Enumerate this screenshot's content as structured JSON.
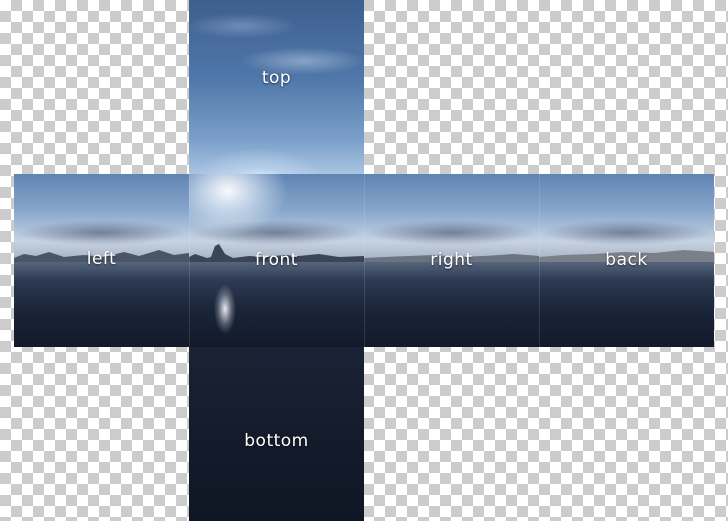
{
  "faces": {
    "top": "top",
    "left": "left",
    "front": "front",
    "right": "right",
    "back": "back",
    "bottom": "bottom"
  },
  "colors": {
    "sky": "#5f84b3",
    "water": "#1a2438",
    "label": "#ffffff",
    "checker_light": "#ffffff",
    "checker_dark": "#cccccc"
  }
}
